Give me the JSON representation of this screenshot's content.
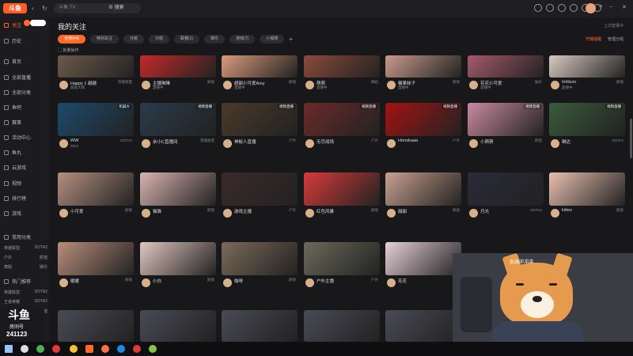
{
  "topbar": {
    "logo": "斗鱼",
    "search_placeholder": "斗鱼 TV",
    "search_button": "搜索",
    "notice": "上次登录中"
  },
  "sidebar": {
    "items": [
      {
        "label": "关注",
        "active": true
      },
      {
        "label": "历史"
      },
      {
        "label": "首页"
      },
      {
        "label": "全部直播"
      },
      {
        "label": "全部分类"
      },
      {
        "label": "鱼吧"
      },
      {
        "label": "赛事"
      },
      {
        "label": "活动中心"
      },
      {
        "label": "鱼丸"
      },
      {
        "label": "云游戏"
      },
      {
        "label": "视频"
      },
      {
        "label": "排行榜"
      },
      {
        "label": "游戏"
      }
    ],
    "section_title": "常用分类",
    "sub_rows": [
      {
        "left": "英雄联盟",
        "right": "DOTA2"
      },
      {
        "left": "户外",
        "right": "颜值"
      },
      {
        "left": "舞蹈",
        "right": "娱乐"
      }
    ],
    "section_title_2": "热门推荐",
    "sub_rows_2": [
      {
        "left": "英雄联盟",
        "right": "DOTA2"
      },
      {
        "left": "王者荣耀",
        "right": "DOTA2"
      },
      {
        "left": "户外",
        "right": "颜值"
      }
    ]
  },
  "main": {
    "title": "我的关注",
    "tabs": [
      {
        "label": "全部(44)",
        "active": true
      },
      {
        "label": "特别关注"
      },
      {
        "label": "分组"
      },
      {
        "label": "分组"
      },
      {
        "label": "联赛(1)"
      },
      {
        "label": "娱乐"
      },
      {
        "label": "游戏(7)"
      },
      {
        "label": "小视频"
      }
    ],
    "batch_label": "批量操作",
    "right_link_1": "开播提醒",
    "right_link_2": "管理分组"
  },
  "cards": [
    {
      "row": 0,
      "col": 0,
      "name": "Happy 1 越越",
      "cat": "英雄联盟",
      "sub": "超级大咖",
      "hot": "",
      "theme": "#6b5a4a"
    },
    {
      "row": 0,
      "col": 1,
      "name": "主播琳琳",
      "cat": "颜值",
      "sub": "直播中",
      "hot": "",
      "theme": "#c22a2a"
    },
    {
      "row": 0,
      "col": 2,
      "name": "超甜小可爱Amy",
      "cat": "颜值",
      "sub": "直播中",
      "hot": "",
      "theme": "#d89a7a"
    },
    {
      "row": 0,
      "col": 3,
      "name": "萌萌",
      "cat": "舞蹈",
      "sub": "直播中",
      "hot": "",
      "theme": "#8b4a3a"
    },
    {
      "row": 0,
      "col": 4,
      "name": "糖果妹子",
      "cat": "颜值",
      "sub": "直播中",
      "hot": "",
      "theme": "#c99a8a"
    },
    {
      "row": 0,
      "col": 5,
      "name": "花花小可爱",
      "cat": "娱乐",
      "sub": "直播中",
      "hot": "",
      "theme": "#a55a6a"
    },
    {
      "row": 0,
      "col": 6,
      "name": "Imilizzo",
      "cat": "颜值",
      "sub": "直播中",
      "hot": "",
      "theme": "#d9c9c0"
    },
    {
      "row": 1,
      "col": 0,
      "name": "WW",
      "cat": "DOTA2",
      "sub": "2023",
      "hot": "",
      "theme": "#1d4a6b",
      "tag": "机器大"
    },
    {
      "row": 1,
      "col": 1,
      "name": "余小C直播间",
      "cat": "英雄联盟",
      "sub": "",
      "hot": "",
      "theme": "#2a3a4a",
      "tag": "视频直播"
    },
    {
      "row": 1,
      "col": 2,
      "name": "神秘人直播",
      "cat": "户外",
      "sub": "",
      "hot": "",
      "theme": "#4a3a2a",
      "tag": "视频直播"
    },
    {
      "row": 1,
      "col": 3,
      "name": "无尽战场",
      "cat": "户外",
      "sub": "",
      "hot": "",
      "theme": "#6b2a2a",
      "tag": "视频直播"
    },
    {
      "row": 1,
      "col": 4,
      "name": "Honokaaa",
      "cat": "户外",
      "sub": "",
      "hot": "",
      "theme": "#a41212",
      "tag": "视频直播"
    },
    {
      "row": 1,
      "col": 5,
      "name": "小萌萌",
      "cat": "颜值",
      "sub": "",
      "hot": "",
      "theme": "#c98aa0",
      "tag": "视频直播"
    },
    {
      "row": 1,
      "col": 6,
      "name": "琳达",
      "cat": "DOTA2",
      "sub": "",
      "hot": "",
      "theme": "#3a5a3a",
      "tag": "视频直播"
    },
    {
      "row": 2,
      "col": 0,
      "name": "小可爱",
      "cat": "颜值",
      "sub": "",
      "hot": "",
      "theme": "#b58f80"
    },
    {
      "row": 2,
      "col": 1,
      "name": "猫猫",
      "cat": "颜值",
      "sub": "",
      "hot": "",
      "theme": "#d9b3b0"
    },
    {
      "row": 2,
      "col": 2,
      "name": "游戏主播",
      "cat": "户外",
      "sub": "",
      "hot": "",
      "theme": "#3a2a2a"
    },
    {
      "row": 2,
      "col": 3,
      "name": "红色风暴",
      "cat": "颜值",
      "sub": "",
      "hot": "",
      "theme": "#d73a3a"
    },
    {
      "row": 2,
      "col": 4,
      "name": "甜甜",
      "cat": "颜值",
      "sub": "",
      "hot": "",
      "theme": "#c9a090"
    },
    {
      "row": 2,
      "col": 5,
      "name": "月光",
      "cat": "DOTA2",
      "sub": "",
      "hot": "",
      "theme": "#2a2a3a"
    },
    {
      "row": 2,
      "col": 6,
      "name": "kitteo",
      "cat": "颜值",
      "sub": "",
      "hot": "",
      "theme": "#e9c0b0"
    },
    {
      "row": 3,
      "col": 0,
      "name": "暖暖",
      "cat": "颜值",
      "sub": "",
      "hot": "",
      "theme": "#b88e7a"
    },
    {
      "row": 3,
      "col": 1,
      "name": "小白",
      "cat": "颜值",
      "sub": "",
      "hot": "",
      "theme": "#e0c6c0"
    },
    {
      "row": 3,
      "col": 2,
      "name": "咖啡",
      "cat": "颜值",
      "sub": "",
      "hot": "",
      "theme": "#7a6a5a"
    },
    {
      "row": 3,
      "col": 3,
      "name": "户外主播",
      "cat": "户外",
      "sub": "",
      "hot": "",
      "theme": "#6a6a5a"
    },
    {
      "row": 3,
      "col": 4,
      "name": "花花",
      "cat": "颜值",
      "sub": "",
      "hot": "",
      "theme": "#e7d0d8"
    }
  ],
  "bottom_cards_count": 5,
  "room": {
    "brand": "斗鱼",
    "label": "房间号",
    "number": "241123"
  },
  "overlay": {
    "bubble": "加油冲冲冲"
  }
}
